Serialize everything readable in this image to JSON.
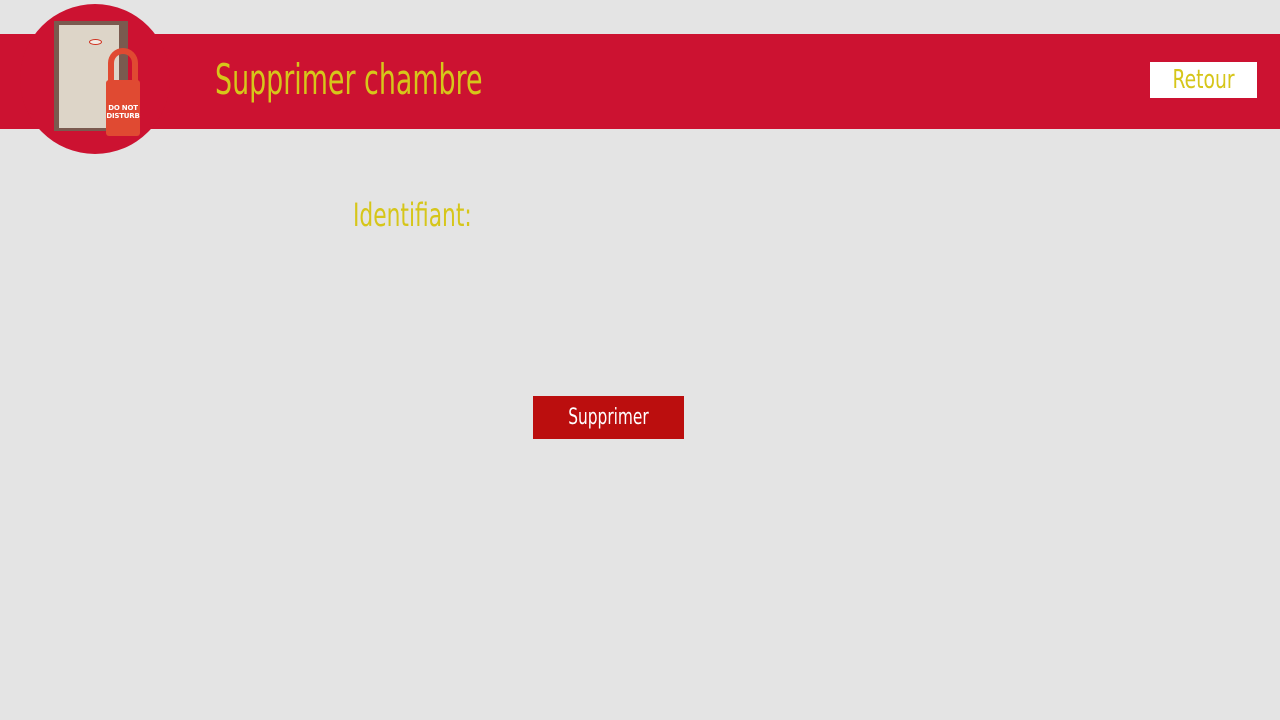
{
  "header": {
    "title": "Supprimer chambre",
    "back_label": "Retour",
    "logo": {
      "icon": "do-not-disturb-door-icon",
      "hanger_text": "DO NOT DISTURB"
    }
  },
  "form": {
    "identifier_label": "Identifiant:",
    "identifier_value": "",
    "identifier_placeholder": "",
    "submit_label": "Supprimer"
  },
  "colors": {
    "background": "#e4e4e4",
    "header": "#cc1231",
    "accent_text": "#d6c61a",
    "delete_button": "#bb0e0e",
    "back_button_bg": "#ffffff"
  }
}
